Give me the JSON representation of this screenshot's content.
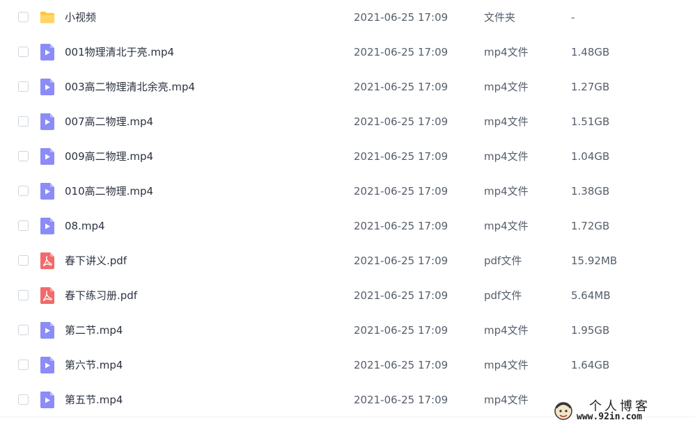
{
  "colors": {
    "folder": "#ffc53d",
    "video": "#8b8cf7",
    "pdf": "#f26a6a",
    "checkbox_border": "#cfd4da"
  },
  "files": [
    {
      "name": "小视频",
      "date": "2021-06-25 17:09",
      "type": "文件夹",
      "size": "-",
      "icon": "folder-icon"
    },
    {
      "name": "001物理清北于亮.mp4",
      "date": "2021-06-25 17:09",
      "type": "mp4文件",
      "size": "1.48GB",
      "icon": "video-file-icon"
    },
    {
      "name": "003高二物理清北余亮.mp4",
      "date": "2021-06-25 17:09",
      "type": "mp4文件",
      "size": "1.27GB",
      "icon": "video-file-icon"
    },
    {
      "name": "007高二物理.mp4",
      "date": "2021-06-25 17:09",
      "type": "mp4文件",
      "size": "1.51GB",
      "icon": "video-file-icon"
    },
    {
      "name": "009高二物理.mp4",
      "date": "2021-06-25 17:09",
      "type": "mp4文件",
      "size": "1.04GB",
      "icon": "video-file-icon"
    },
    {
      "name": "010高二物理.mp4",
      "date": "2021-06-25 17:09",
      "type": "mp4文件",
      "size": "1.38GB",
      "icon": "video-file-icon"
    },
    {
      "name": "08.mp4",
      "date": "2021-06-25 17:09",
      "type": "mp4文件",
      "size": "1.72GB",
      "icon": "video-file-icon"
    },
    {
      "name": "春下讲义.pdf",
      "date": "2021-06-25 17:09",
      "type": "pdf文件",
      "size": "15.92MB",
      "icon": "pdf-file-icon"
    },
    {
      "name": "春下练习册.pdf",
      "date": "2021-06-25 17:09",
      "type": "pdf文件",
      "size": "5.64MB",
      "icon": "pdf-file-icon"
    },
    {
      "name": "第二节.mp4",
      "date": "2021-06-25 17:09",
      "type": "mp4文件",
      "size": "1.95GB",
      "icon": "video-file-icon"
    },
    {
      "name": "第六节.mp4",
      "date": "2021-06-25 17:09",
      "type": "mp4文件",
      "size": "1.64GB",
      "icon": "video-file-icon"
    },
    {
      "name": "第五节.mp4",
      "date": "2021-06-25 17:09",
      "type": "mp4文件",
      "size": "",
      "icon": "video-file-icon"
    }
  ],
  "watermark": {
    "title": "个人博客",
    "url": "www.92in.com"
  }
}
